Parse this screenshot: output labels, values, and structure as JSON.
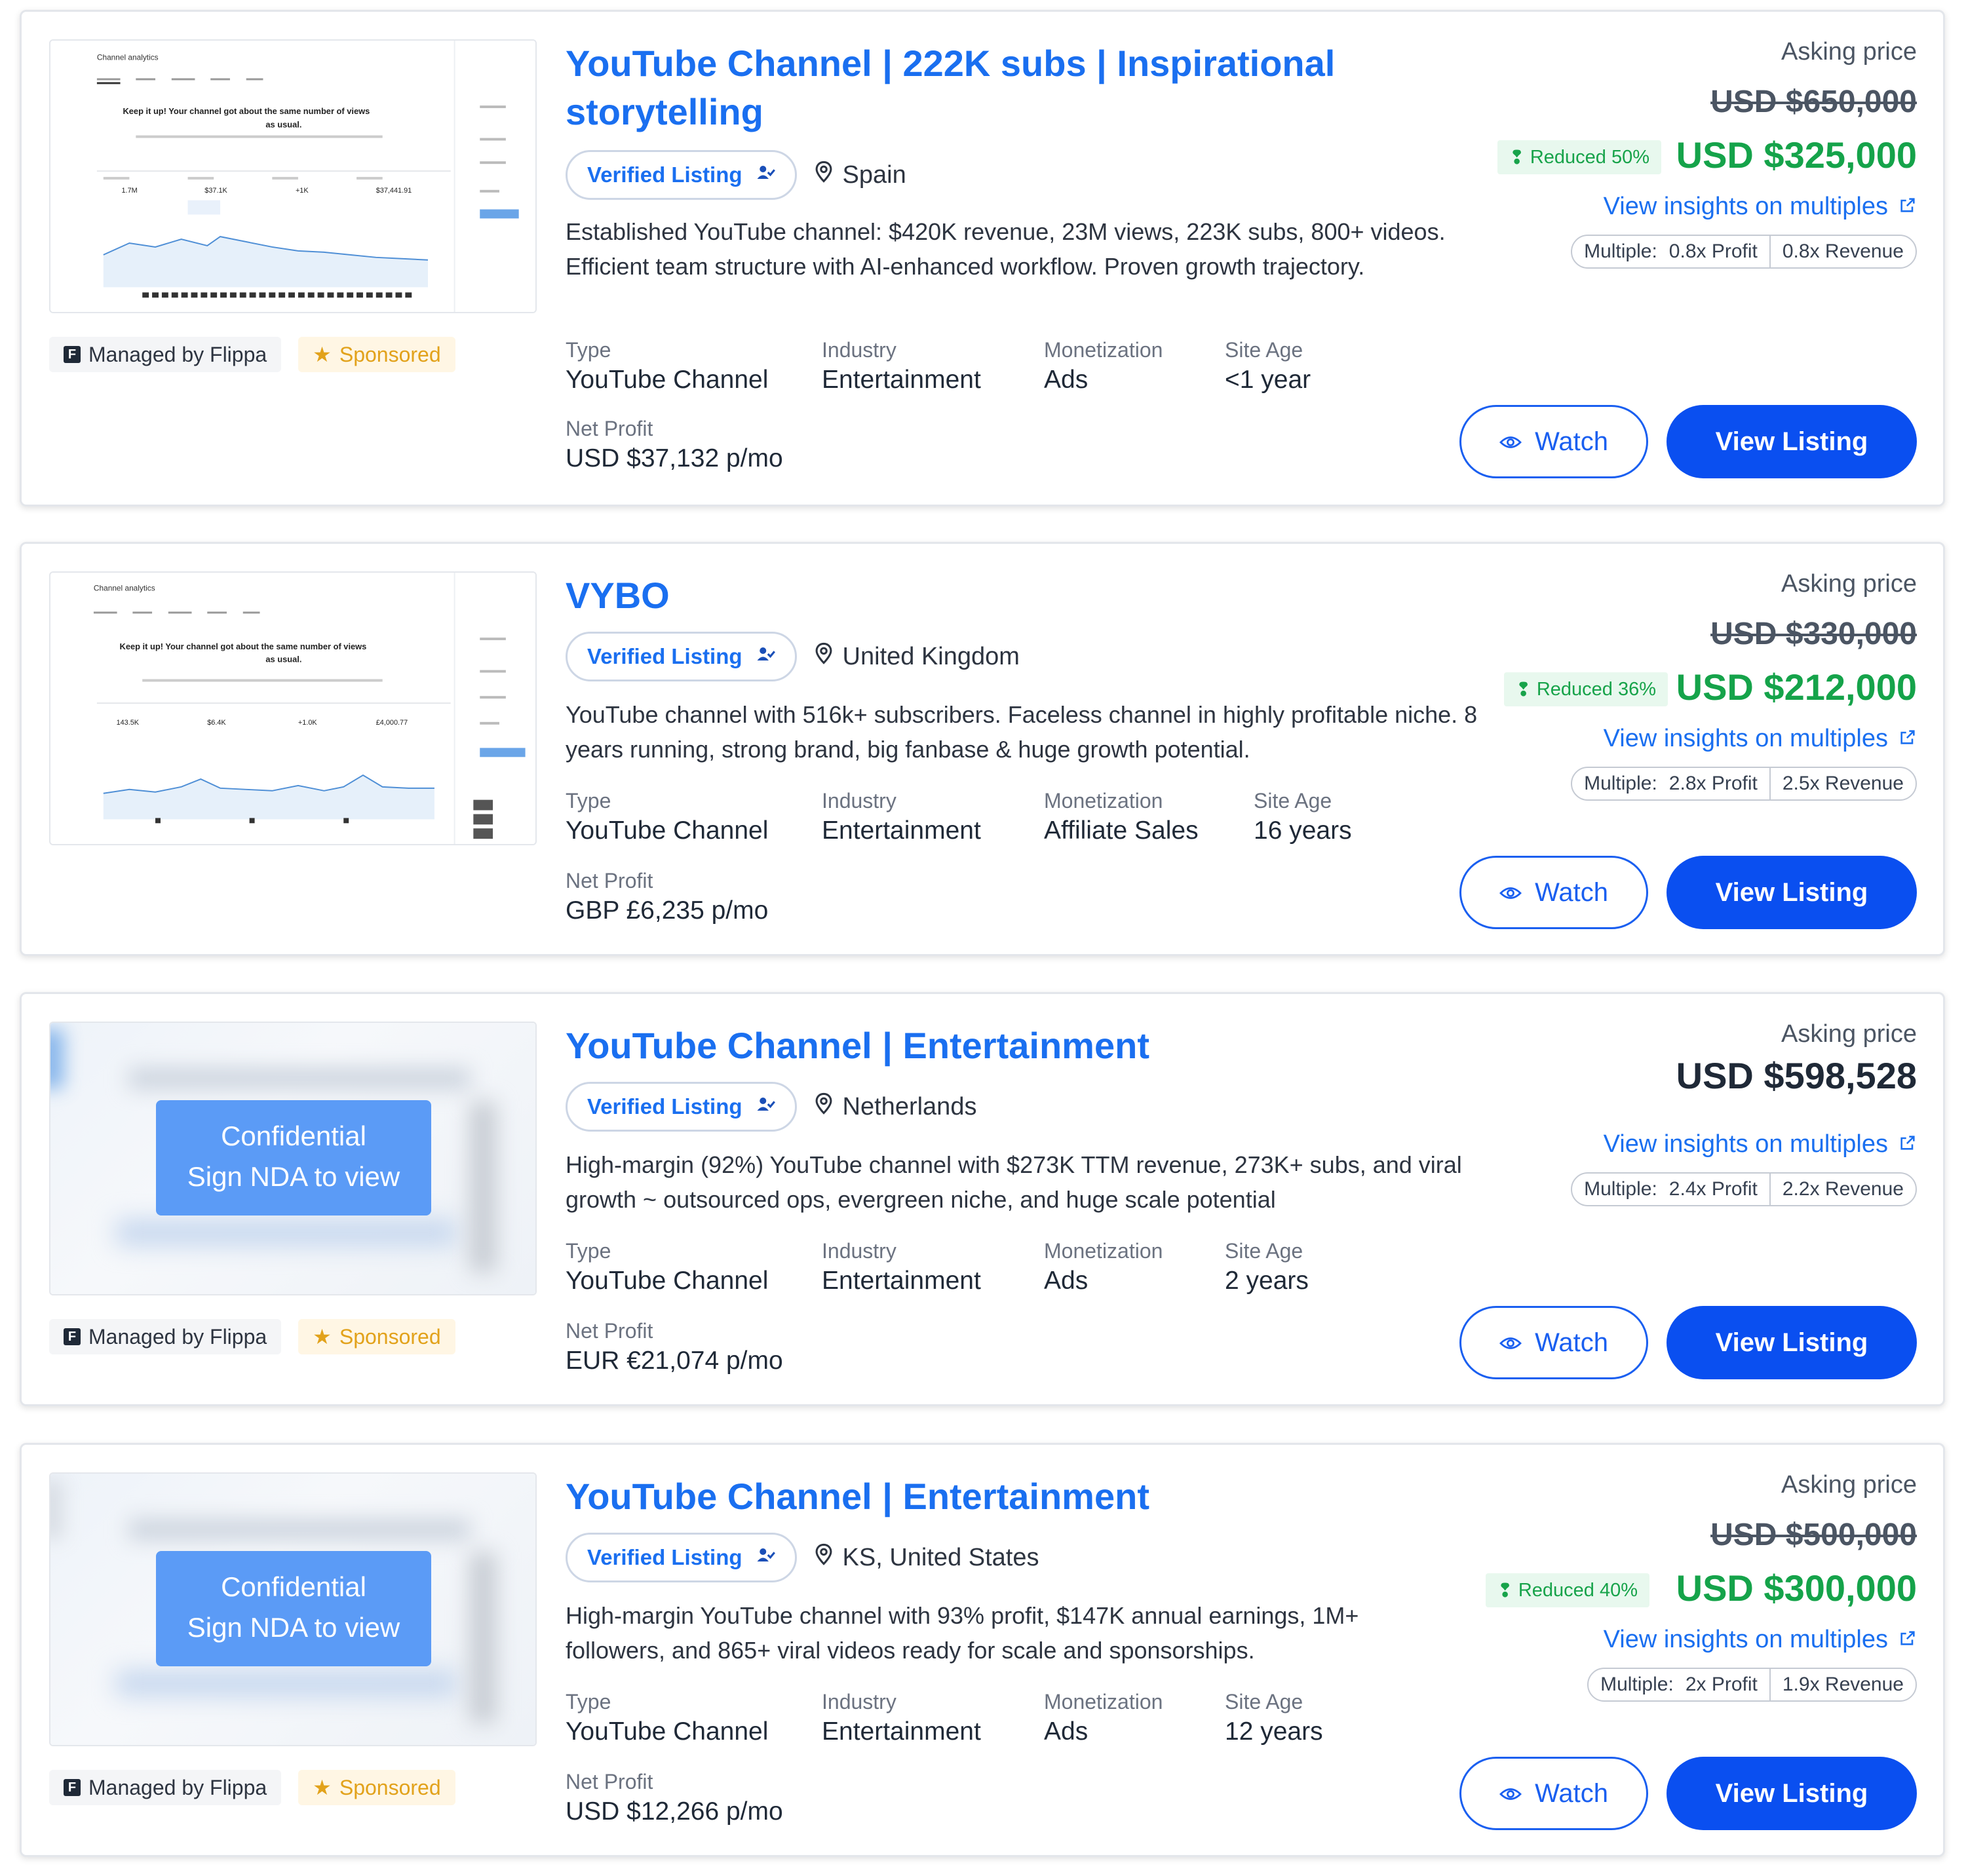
{
  "common": {
    "verified_label": "Verified Listing",
    "asking_label": "Asking price",
    "insights_label": "View insights on multiples",
    "multiple_label": "Multiple:",
    "managed_label": "Managed by Flippa",
    "sponsored_label": "Sponsored",
    "watch_label": "Watch",
    "view_label": "View Listing",
    "nda_line1": "Confidential",
    "nda_line2": "Sign NDA to view",
    "type_label": "Type",
    "industry_label": "Industry",
    "monetization_label": "Monetization",
    "site_age_label": "Site Age",
    "net_profit_label": "Net Profit"
  },
  "thumb_text": {
    "channel_analytics": "Channel analytics",
    "keep_it_up_l1": "Keep it up! Your channel got about the same number of views",
    "keep_it_up_l2": "as usual.",
    "l1_stats": [
      "1.7M",
      "$37.1K",
      "+1K",
      "$37,441.91"
    ],
    "l2_stats": [
      "143.5K",
      "$6.4K",
      "+1.0K",
      "£4,000.77"
    ]
  },
  "listings": [
    {
      "title": "YouTube Channel | 222K subs | Inspirational storytelling",
      "location": "Spain",
      "description": "Established YouTube channel: $420K revenue, 23M views, 223K subs, 800+ videos. Efficient team structure with AI-enhanced workflow. Proven growth trajectory.",
      "type": "YouTube Channel",
      "industry": "Entertainment",
      "monetization": "Ads",
      "site_age": "<1 year",
      "net_profit": "USD $37,132 p/mo",
      "old_price": "USD $650,000",
      "price": "USD $325,000",
      "reduced": "Reduced 50%",
      "multiple_profit": "0.8x Profit",
      "multiple_revenue": "0.8x Revenue"
    },
    {
      "title": "VYBO",
      "location": "United Kingdom",
      "description": "YouTube channel with 516k+ subscribers. Faceless channel in highly profitable niche. 8 years running, strong brand, big fanbase & huge growth potential.",
      "type": "YouTube Channel",
      "industry": "Entertainment",
      "monetization": "Affiliate Sales",
      "site_age": "16 years",
      "net_profit": "GBP £6,235 p/mo",
      "old_price": "USD $330,000",
      "price": "USD $212,000",
      "reduced": "Reduced 36%",
      "multiple_profit": "2.8x Profit",
      "multiple_revenue": "2.5x Revenue"
    },
    {
      "title": "YouTube Channel | Entertainment",
      "location": "Netherlands",
      "description": "High-margin (92%) YouTube channel with $273K TTM revenue, 273K+ subs, and viral growth ~ outsourced ops, evergreen niche, and huge scale potential",
      "type": "YouTube Channel",
      "industry": "Entertainment",
      "monetization": "Ads",
      "site_age": "2 years",
      "net_profit": "EUR €21,074 p/mo",
      "price": "USD $598,528",
      "multiple_profit": "2.4x Profit",
      "multiple_revenue": "2.2x Revenue"
    },
    {
      "title": "YouTube Channel | Entertainment",
      "location": "KS, United States",
      "description": "High-margin YouTube channel with 93% profit, $147K annual earnings, 1M+ followers, and 865+ viral videos ready for scale and sponsorships.",
      "type": "YouTube Channel",
      "industry": "Entertainment",
      "monetization": "Ads",
      "site_age": "12 years",
      "net_profit": "USD $12,266 p/mo",
      "old_price": "USD $500,000",
      "price": "USD $300,000",
      "reduced": "Reduced 40%",
      "multiple_profit": "2x Profit",
      "multiple_revenue": "1.9x Revenue"
    }
  ],
  "colors": {
    "link_blue": "#1a6ff0",
    "button_blue": "#0a4ff0",
    "price_green": "#15a34a",
    "sponsored_gold": "#e2a21b"
  },
  "icons": {
    "verified": "verified-badge-icon",
    "location": "location-pin-icon",
    "watch": "eye-icon",
    "insights": "external-link-icon",
    "reduced": "price-tag-icon",
    "sponsored": "star-icon",
    "managed": "flippa-logo-icon"
  }
}
